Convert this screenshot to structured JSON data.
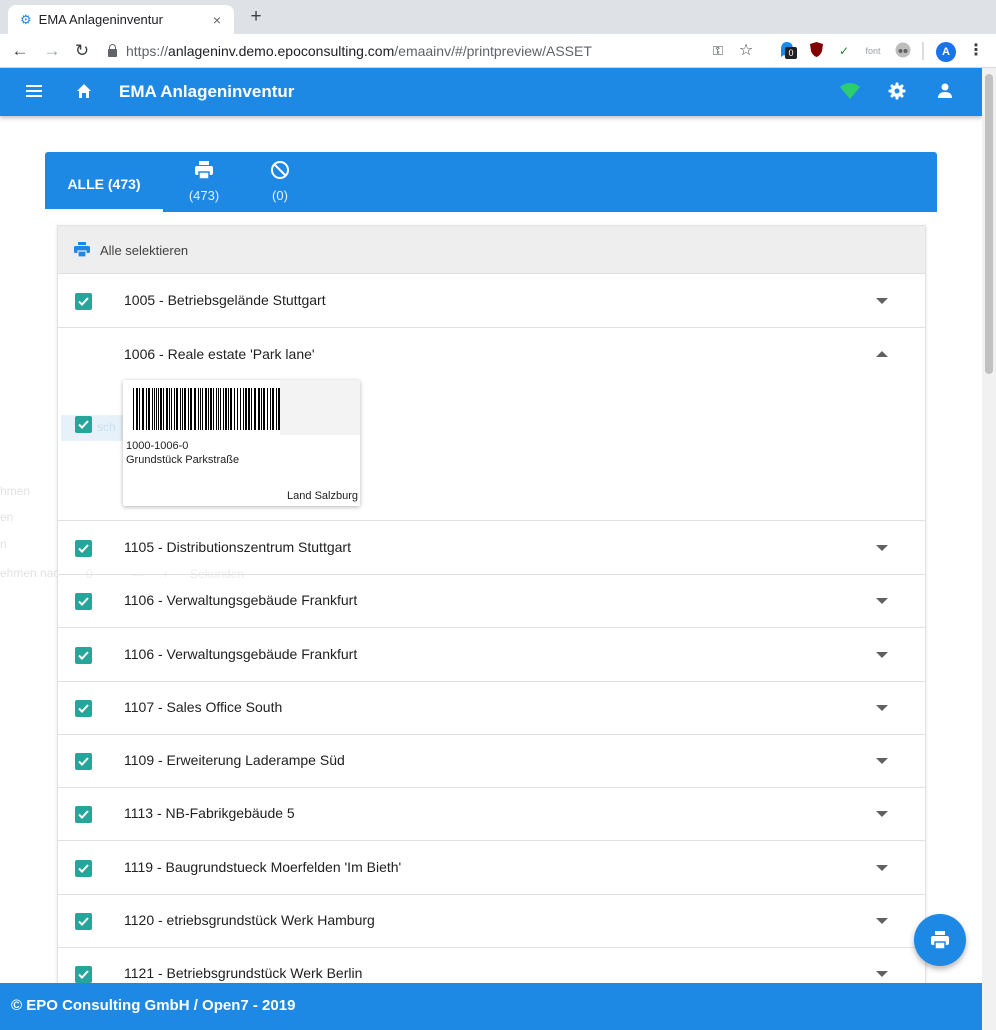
{
  "browser": {
    "tab_title": "EMA Anlageninventur",
    "tab_close": "×",
    "new_tab": "+",
    "url_base": "https://",
    "url_host": "anlageninv.demo.epoconsulting.com",
    "url_path": "/emaainv/#/printpreview/ASSET",
    "ext_badge": "0",
    "ext_font_label": "font",
    "profile_initial": "A",
    "icons": [
      "back-icon",
      "forward-icon",
      "reload-icon",
      "lock-icon",
      "key-icon",
      "star-icon",
      "profile-icon",
      "menu-dots-icon"
    ]
  },
  "header": {
    "title": "EMA Anlageninventur",
    "status_color": "#2ecc71"
  },
  "tabs": {
    "all_label": "ALLE (473)",
    "print_count": "(473)",
    "blocked_count": "(0)"
  },
  "list": {
    "select_all_label": "Alle selektieren",
    "expanded": {
      "label": "1006 - Reale estate 'Park lane'",
      "card_code": "1000-1006-0",
      "card_description": "Grundstück Parkstraße",
      "card_location": "Land Salzburg"
    },
    "items": [
      {
        "label": "1005 - Betriebsgelände Stuttgart"
      },
      {
        "label": "1105 - Distributionszentrum Stuttgart"
      },
      {
        "label": "1106 - Verwaltungsgebäude Frankfurt"
      },
      {
        "label": "1106 - Verwaltungsgebäude Frankfurt"
      },
      {
        "label": "1107 - Sales Office South"
      },
      {
        "label": "1109 - Erweiterung Laderampe Süd"
      },
      {
        "label": "1113 - NB-Fabrikgebäude 5"
      },
      {
        "label": "1119 - Baugrundstueck Moerfelden 'Im Bieth'"
      },
      {
        "label": "1120 - etriebsgrundstück Werk Hamburg"
      },
      {
        "label": "1121 - Betriebsgrundstück Werk Berlin"
      }
    ]
  },
  "ghost": {
    "band_text": "sch",
    "left_1": "hmen",
    "left_2": "en",
    "left_3": "n",
    "left_4": "ehmen nach",
    "zero": "0",
    "minus": "—",
    "plus": "+",
    "seconds": "Sekunden"
  },
  "footer": {
    "text": "© EPO Consulting GmbH / Open7 - 2019"
  },
  "colors": {
    "primary": "#1e88e5",
    "checkbox": "#26a69a"
  }
}
